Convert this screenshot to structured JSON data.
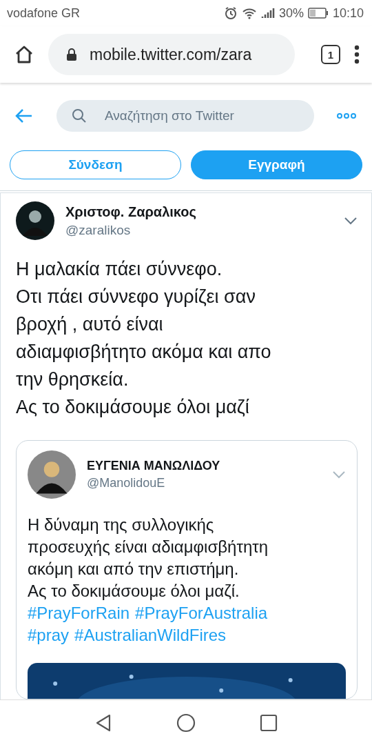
{
  "status_bar": {
    "carrier": "vodafone GR",
    "battery": "30%",
    "time": "10:10"
  },
  "browser": {
    "url": "mobile.twitter.com/zara",
    "tab_count": "1"
  },
  "header": {
    "search_placeholder": "Αναζήτηση στο Twitter"
  },
  "auth_buttons": [
    {
      "label": "Σύνδεση",
      "kind": "outline"
    },
    {
      "label": "Εγγραφή",
      "kind": "filled"
    }
  ],
  "tweet": {
    "name": "Χριστοφ. Ζαραλικος",
    "handle": "@zaralikos",
    "text": "Η μαλακία πάει σύννεφο.\nΟτι πάει σύννεφο γυρίζει σαν\nβροχή , αυτό είναι\nαδιαμφισβήτητο ακόμα και απο\nτην θρησκεία.\nΑς το δοκιμάσουμε όλοι μαζί",
    "quoted": {
      "name": "ΕΥΓΕΝΙΑ ΜΑΝΩΛΙΔΟΥ",
      "handle": "@ManolidouE",
      "text": "Η δύναμη της συλλογικής\nπροσευχής είναι αδιαμφισβήτητη\nακόμη και από την επιστήμη.\nΑς το δοκιμάσουμε όλοι μαζί.",
      "hashtags": [
        "#PrayForRain",
        "#PrayForAustralia",
        "#pray",
        "#AustralianWildFires"
      ]
    }
  }
}
